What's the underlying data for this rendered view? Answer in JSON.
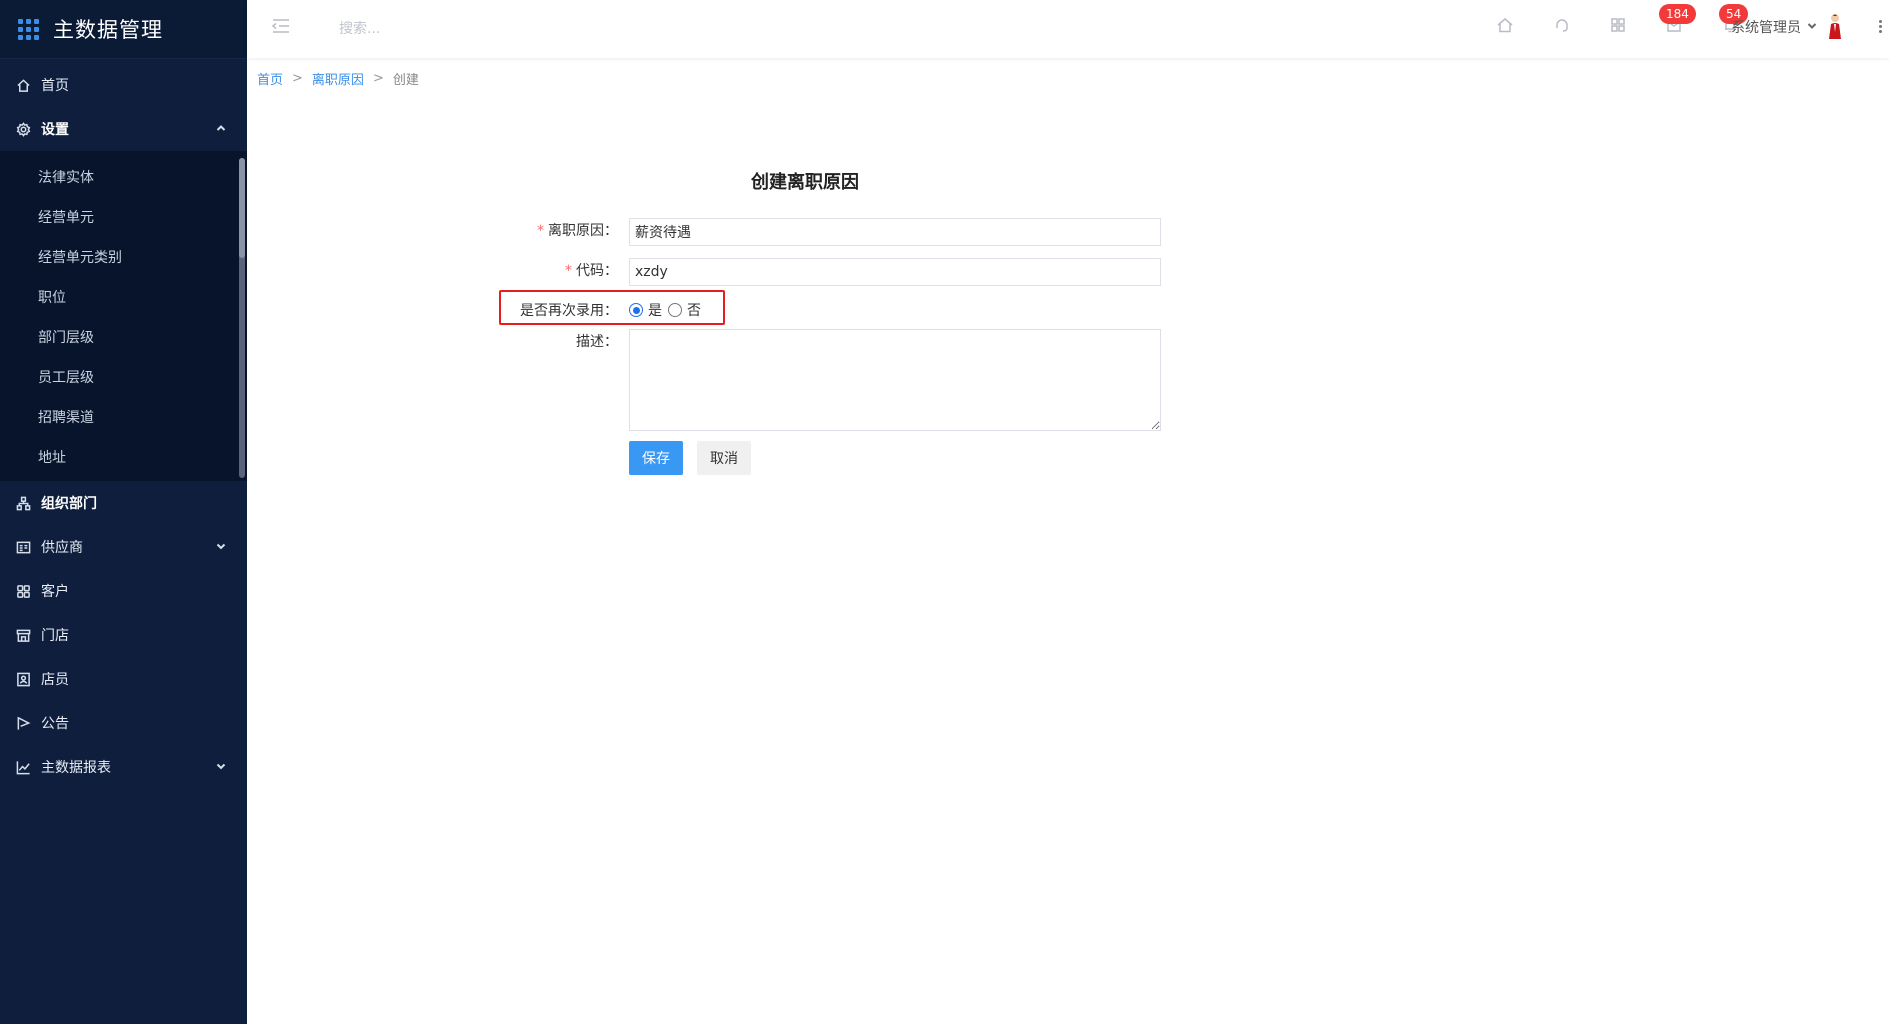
{
  "app": {
    "title": "主数据管理"
  },
  "sidebar": {
    "home": "首页",
    "settings": {
      "label": "设置",
      "children": [
        "法律实体",
        "经营单元",
        "经营单元类别",
        "职位",
        "部门层级",
        "员工层级",
        "招聘渠道",
        "地址"
      ]
    },
    "org": "组织部门",
    "supplier": "供应商",
    "customer": "客户",
    "store": "门店",
    "clerk": "店员",
    "notice": "公告",
    "report": "主数据报表"
  },
  "header": {
    "search_placeholder": "搜索...",
    "badge_messages": "184",
    "badge_notifications": "54",
    "user_name": "系统管理员"
  },
  "breadcrumb": {
    "home": "首页",
    "section": "离职原因",
    "current": "创建"
  },
  "form": {
    "title": "创建离职原因",
    "reason_label": "离职原因：",
    "reason_value": "薪资待遇",
    "code_label": "代码：",
    "code_value": "xzdy",
    "rehire_label": "是否再次录用：",
    "rehire_yes": "是",
    "rehire_no": "否",
    "desc_label": "描述：",
    "required_mark": "*",
    "save": "保存",
    "cancel": "取消"
  },
  "colors": {
    "sidebar_bg": "#0e1e3c",
    "accent": "#3a98f5",
    "highlight": "#e51f1f",
    "badge": "#f23a3a"
  }
}
